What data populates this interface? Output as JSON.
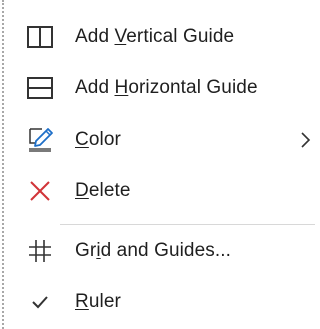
{
  "menu": {
    "items": [
      {
        "pre": "Add ",
        "key": "V",
        "post": "ertical Guide",
        "icon": "vertical-guide-icon"
      },
      {
        "pre": "Add ",
        "key": "H",
        "post": "orizontal Guide",
        "icon": "horizontal-guide-icon"
      },
      {
        "pre": "",
        "key": "C",
        "post": "olor",
        "icon": "pen-color-icon",
        "submenu": true
      },
      {
        "pre": "",
        "key": "D",
        "post": "elete",
        "icon": "delete-x-icon"
      },
      {
        "pre": "Gr",
        "key": "i",
        "post": "d and Guides...",
        "icon": "grid-hash-icon"
      },
      {
        "pre": "",
        "key": "R",
        "post": "uler",
        "icon": "checkmark-icon",
        "checked": true
      }
    ],
    "colors": {
      "guide_icon": "#333333",
      "pen_blue": "#1e6fc8",
      "pen_bar": "#7a7a7a",
      "delete_red": "#d13438",
      "text": "#1f1f1f",
      "separator": "#d8d8d8"
    }
  }
}
